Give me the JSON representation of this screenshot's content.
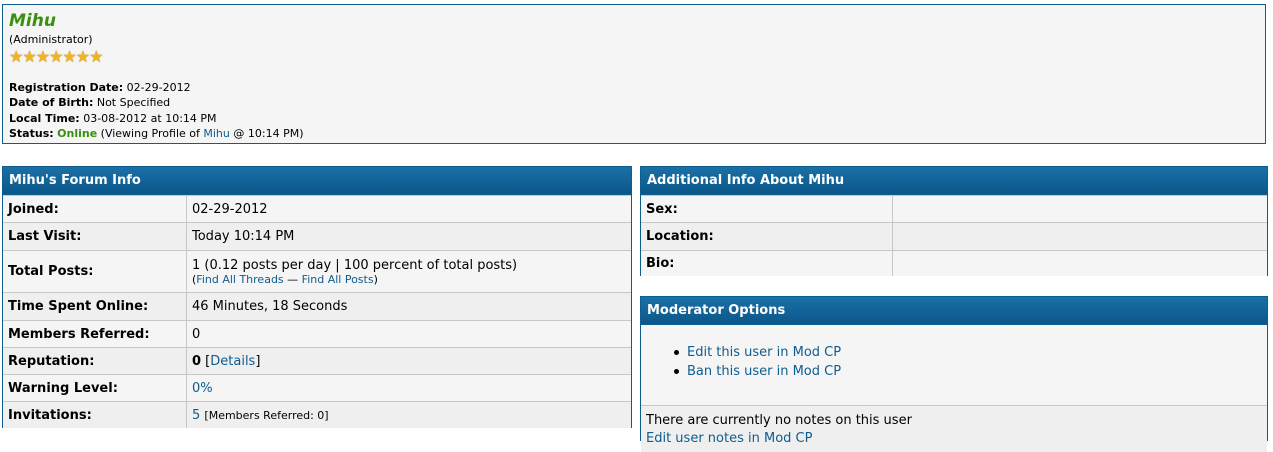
{
  "profile": {
    "username": "Mihu",
    "usertitle": "(Administrator)",
    "stars": 7,
    "registration_label": "Registration Date:",
    "registration_value": "02-29-2012",
    "dob_label": "Date of Birth:",
    "dob_value": "Not Specified",
    "localtime_label": "Local Time:",
    "localtime_value": "03-08-2012 at 10:14 PM",
    "status_label": "Status:",
    "status_value": "Online",
    "status_detail_prefix": "(Viewing Profile of",
    "status_detail_user": "Mihu",
    "status_detail_suffix": "@ 10:14 PM)"
  },
  "forum_info": {
    "title": "Mihu's Forum Info",
    "joined_label": "Joined:",
    "joined_value": "02-29-2012",
    "lastvisit_label": "Last Visit:",
    "lastvisit_value": "Today 10:14 PM",
    "totalposts_label": "Total Posts:",
    "totalposts_value": "1 (0.12 posts per day | 100 percent of total posts)",
    "find_threads": "Find All Threads",
    "find_sep": "—",
    "find_posts": "Find All Posts",
    "timeonline_label": "Time Spent Online:",
    "timeonline_value": "46 Minutes, 18 Seconds",
    "referred_label": "Members Referred:",
    "referred_value": "0",
    "reputation_label": "Reputation:",
    "reputation_value": "0",
    "reputation_details": "Details",
    "warning_label": "Warning Level:",
    "warning_value": "0%",
    "invitations_label": "Invitations:",
    "invitations_value": "5",
    "invitations_note": "[Members Referred: 0]"
  },
  "additional_info": {
    "title": "Additional Info About Mihu",
    "sex_label": "Sex:",
    "sex_value": "",
    "location_label": "Location:",
    "location_value": "",
    "bio_label": "Bio:",
    "bio_value": ""
  },
  "moderator": {
    "title": "Moderator Options",
    "edit_link": "Edit this user in Mod CP",
    "ban_link": "Ban this user in Mod CP",
    "notes_text": "There are currently no notes on this user",
    "notes_link": "Edit user notes in Mod CP"
  },
  "colors": {
    "header_blue": "#0f5c8e",
    "username_green": "#3a8f0f",
    "link_blue": "#0f5c8e",
    "star_gold": "#f2b41e"
  }
}
